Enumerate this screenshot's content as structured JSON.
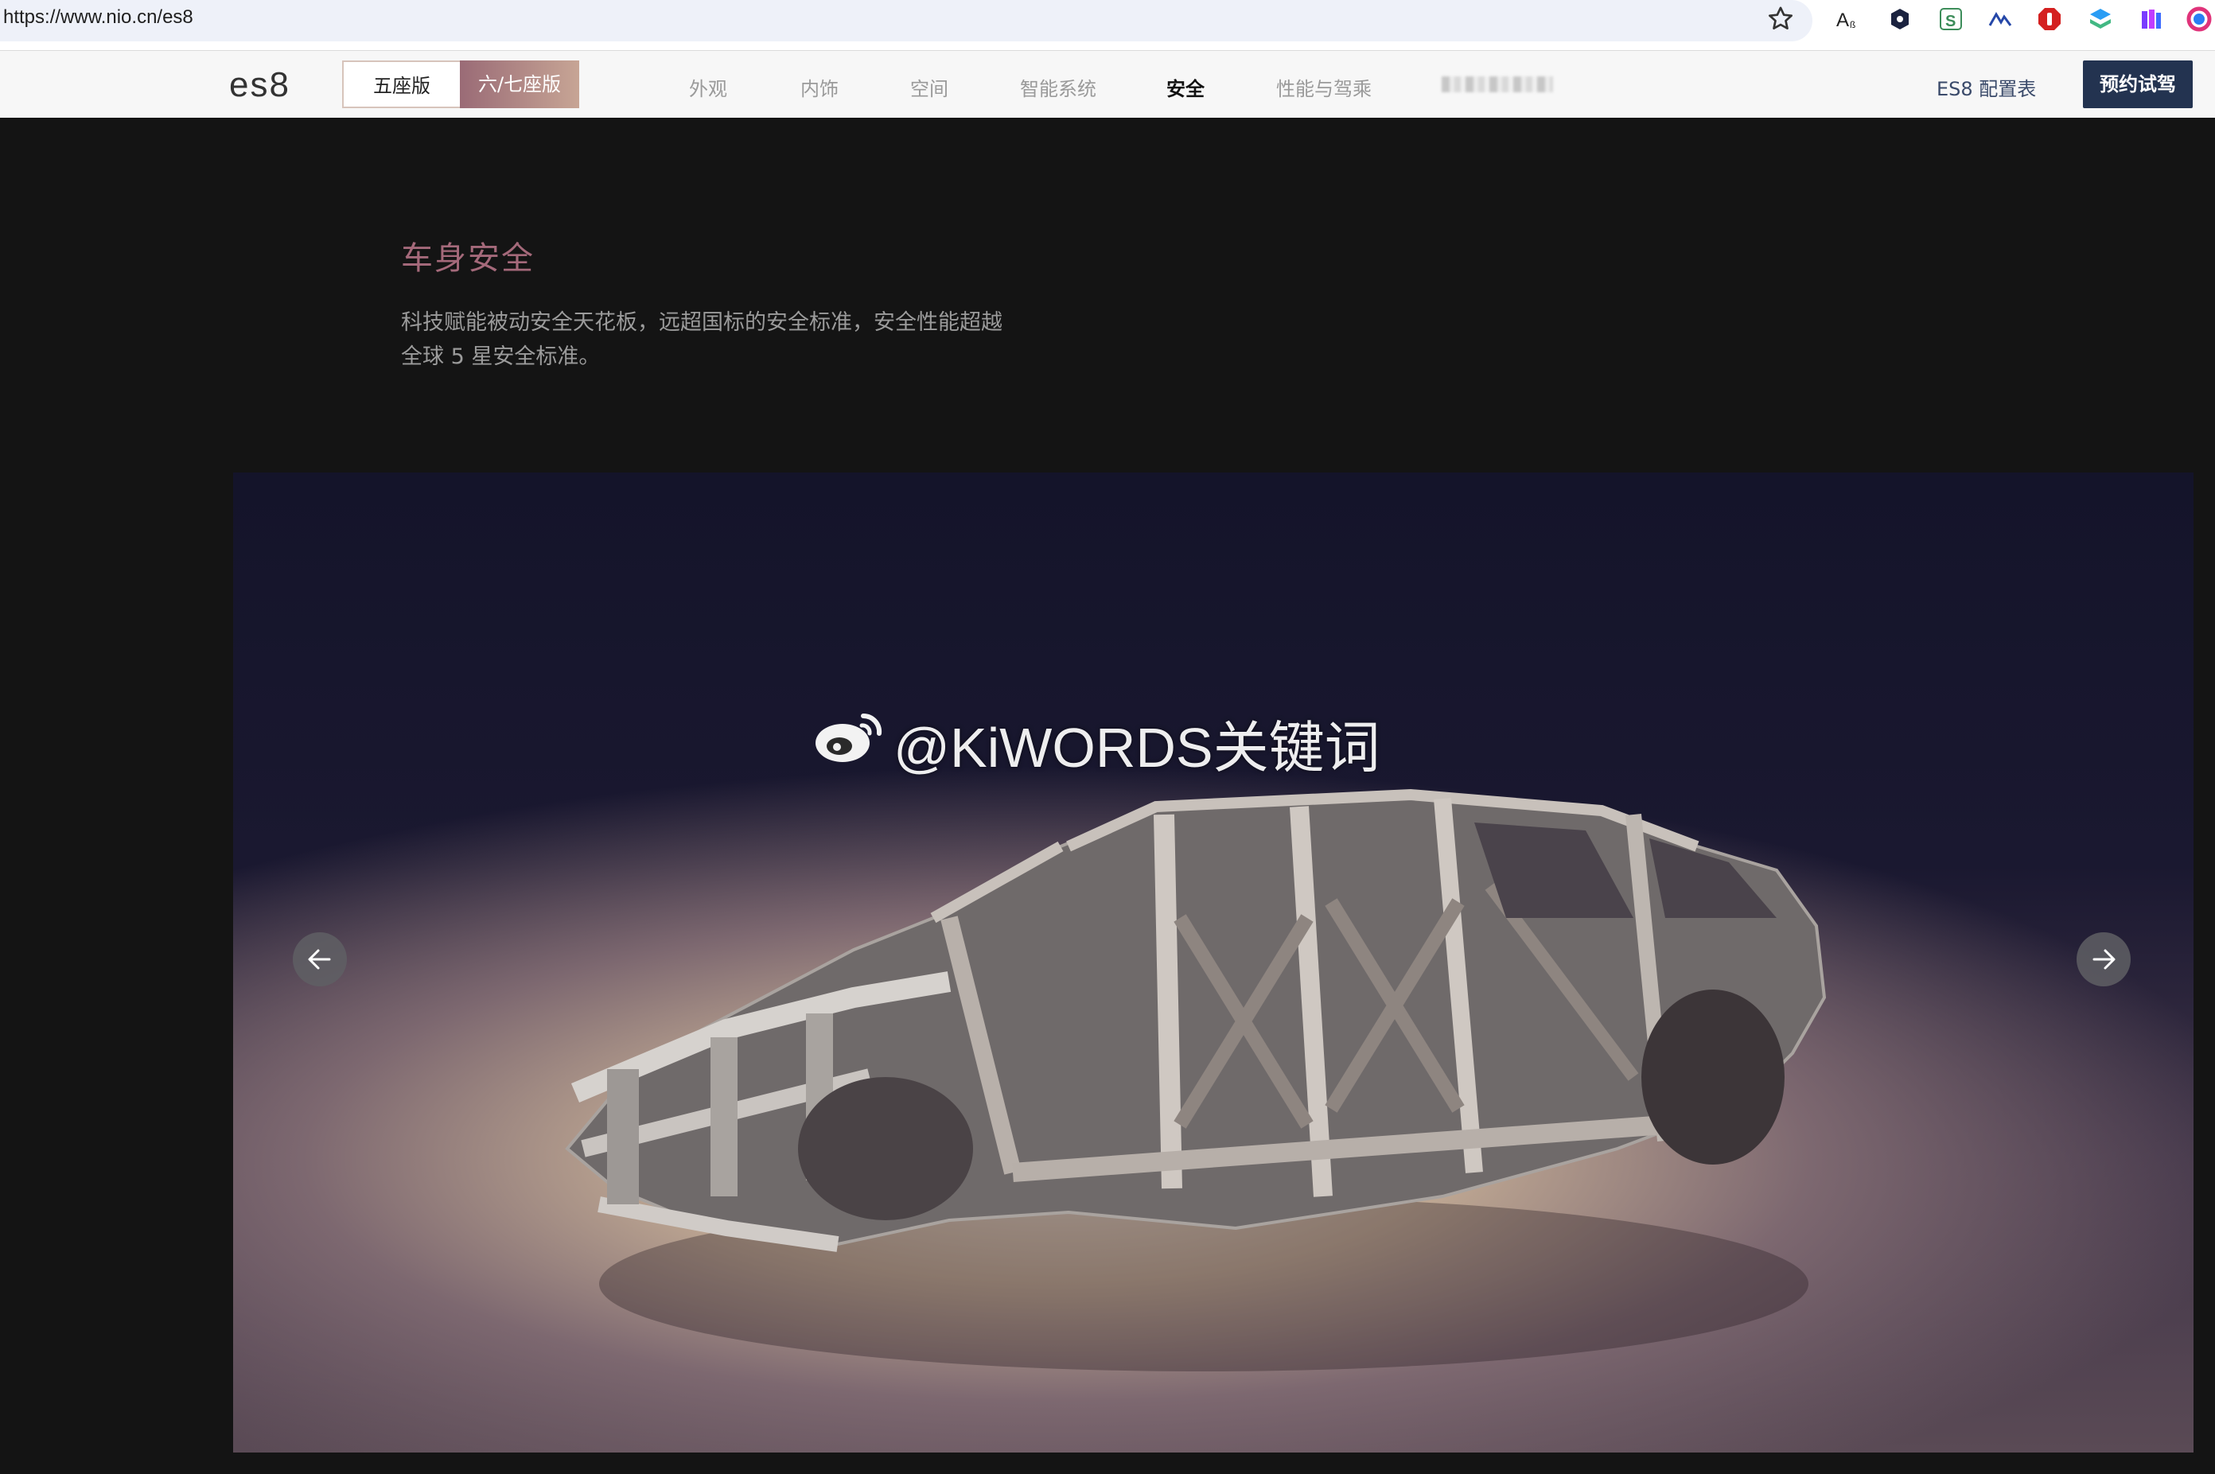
{
  "browser": {
    "url": "https://www.nio.cn/es8",
    "extensions": [
      "read-aloud-icon",
      "hex-extension-icon",
      "s-extension-icon",
      "mountain-extension-icon",
      "red-extension-icon",
      "layers-extension-icon",
      "purple-extension-icon",
      "ring-extension-icon"
    ]
  },
  "nav": {
    "logo": "es8",
    "variants": {
      "five_seat": "五座版",
      "six_seven_seat": "六/七座版"
    },
    "links": [
      {
        "label": "外观",
        "active": false
      },
      {
        "label": "内饰",
        "active": false
      },
      {
        "label": "空间",
        "active": false
      },
      {
        "label": "智能系统",
        "active": false
      },
      {
        "label": "安全",
        "active": true
      },
      {
        "label": "性能与驾乘",
        "active": false
      }
    ],
    "config_link": "ES8 配置表",
    "test_drive": "预约试驾"
  },
  "section": {
    "title": "车身安全",
    "description_line1": "科技赋能被动安全天花板，远超国标的安全标准，安全性能超越",
    "description_line2": "全球 5 星安全标准。"
  },
  "carousel": {
    "image_subject": "car-body-frame-image",
    "watermark": "@KiWORDS关键词"
  },
  "colors": {
    "accent_title": "#a4697a",
    "cta_background": "#233350",
    "page_background": "#141414"
  }
}
